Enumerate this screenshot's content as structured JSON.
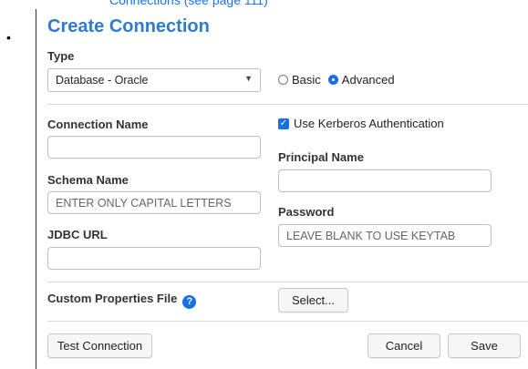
{
  "top_link": "Connections (see page 111)",
  "bullet": "•",
  "dialog": {
    "title": "Create Connection",
    "type": {
      "label": "Type",
      "selected": "Database - Oracle",
      "arrow": "▼"
    },
    "mode": {
      "options": [
        "Basic",
        "Advanced"
      ],
      "selected": "Advanced"
    },
    "connection_name": {
      "label": "Connection Name",
      "value": ""
    },
    "kerberos": {
      "label": "Use Kerberos Authentication",
      "checked": true
    },
    "principal_name": {
      "label": "Principal Name",
      "value": ""
    },
    "schema_name": {
      "label": "Schema Name",
      "placeholder": "ENTER ONLY CAPITAL LETTERS"
    },
    "password": {
      "label": "Password",
      "placeholder": "LEAVE BLANK TO USE KEYTAB"
    },
    "jdbc_url": {
      "label": "JDBC URL",
      "value": ""
    },
    "custom_properties": {
      "label": "Custom Properties File",
      "help": "?",
      "select_label": "Select..."
    },
    "footer": {
      "test_label": "Test Connection",
      "cancel_label": "Cancel",
      "save_label": "Save"
    },
    "accent_color": "#1a6fe0",
    "title_color": "#2f7bd2"
  }
}
